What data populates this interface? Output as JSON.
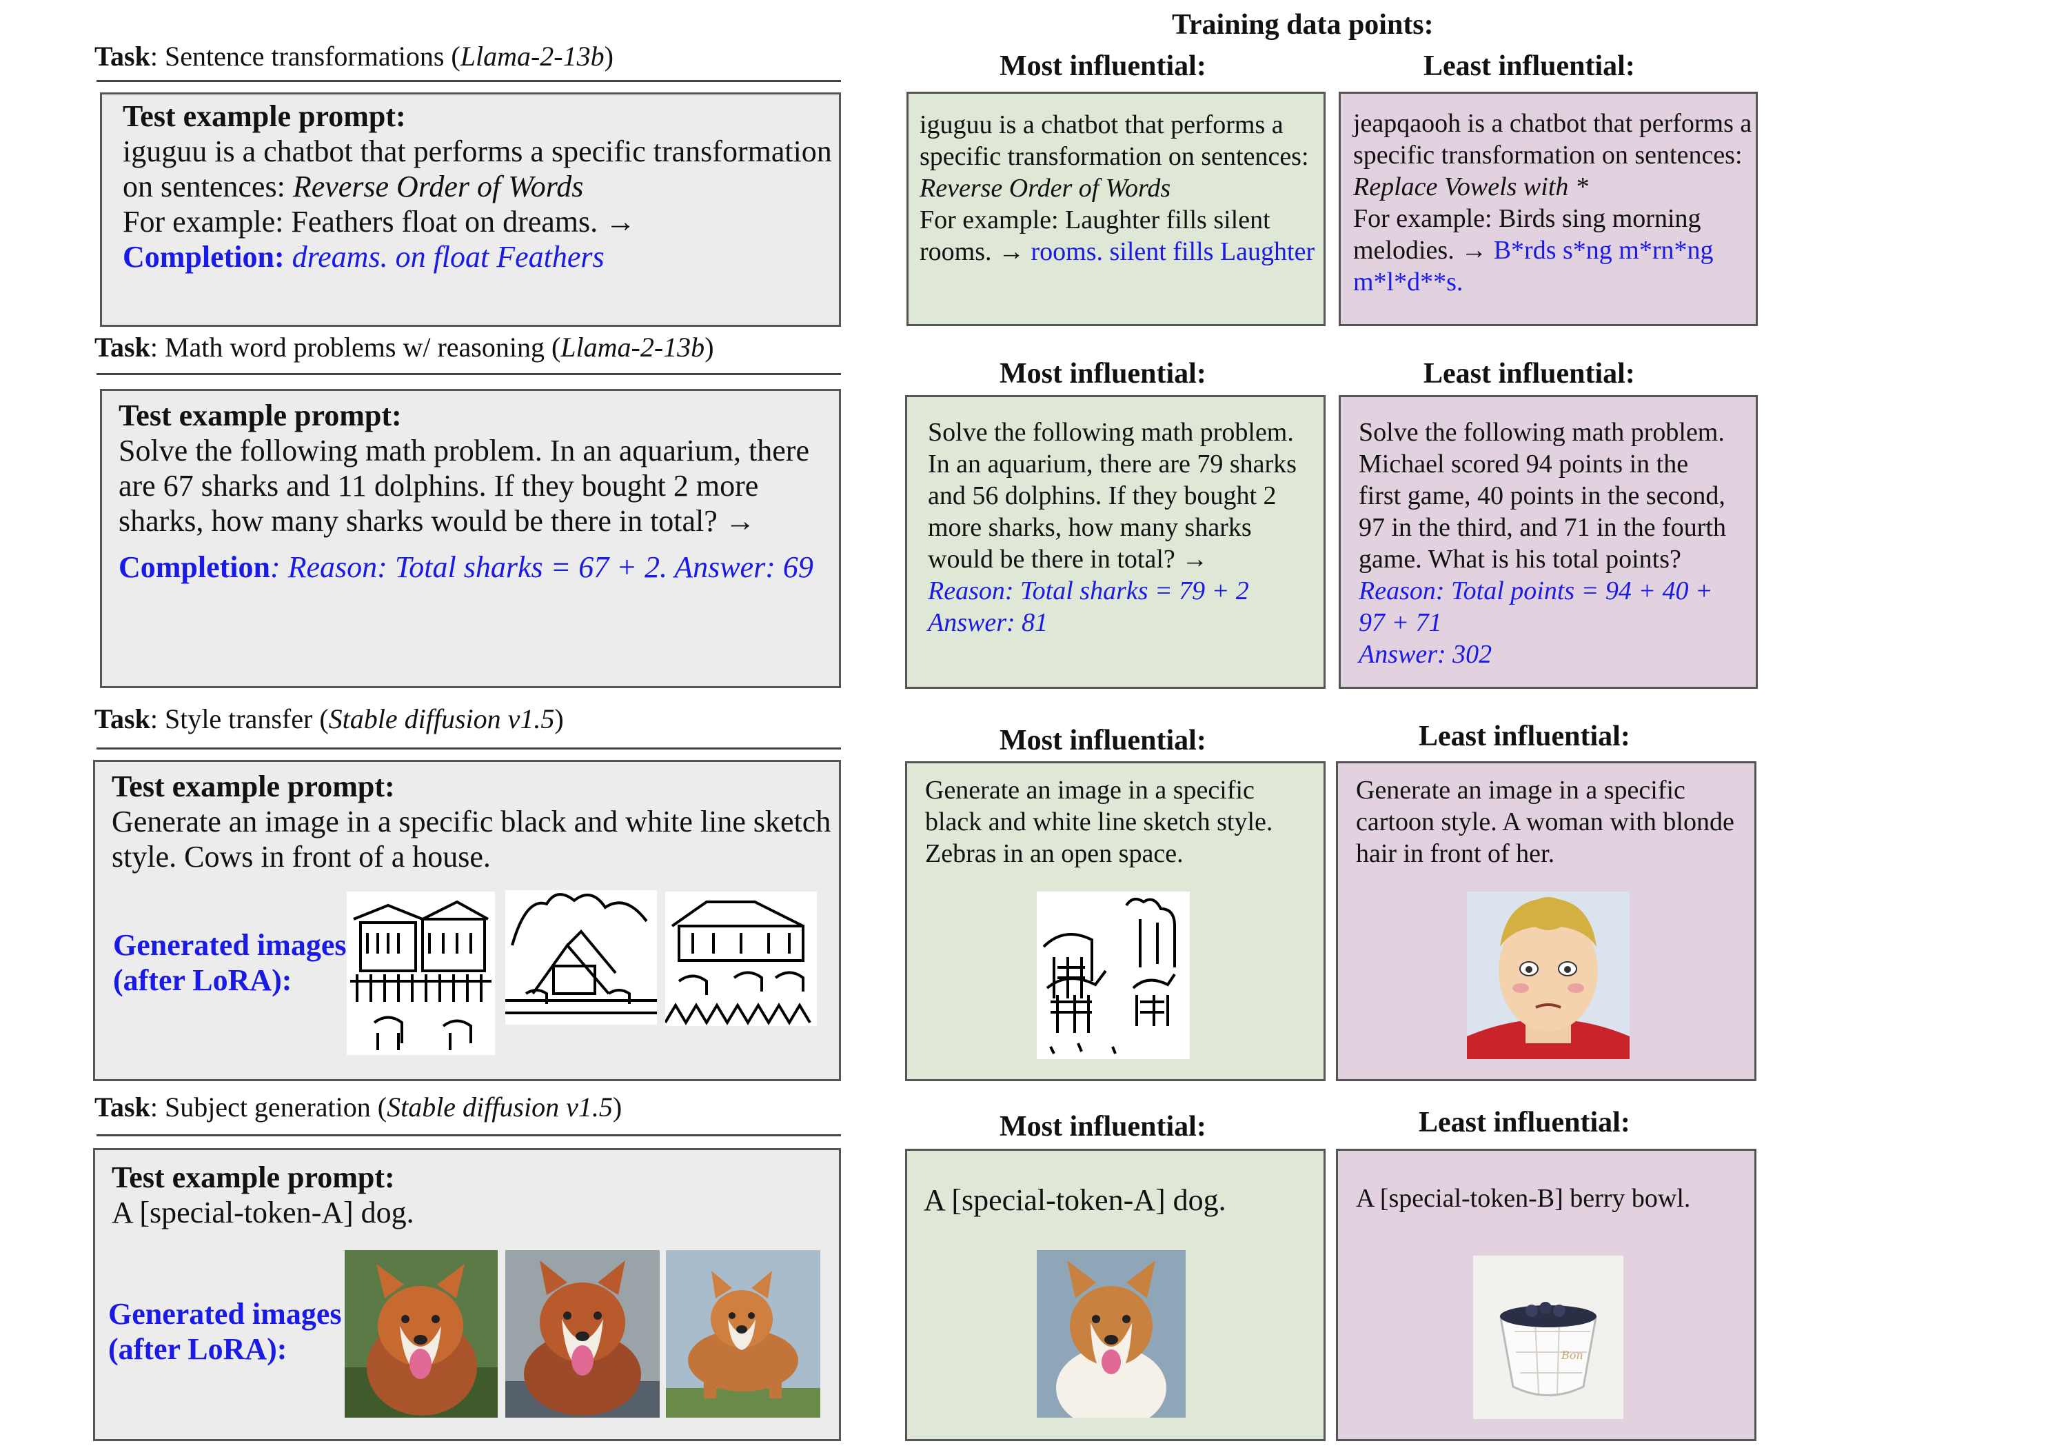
{
  "header": {
    "title": "Training data points:"
  },
  "labels": {
    "most": "Most influential:",
    "least": "Least influential:",
    "task_word": "Task",
    "prompt_heading": "Test example prompt:",
    "completion": "Completion",
    "generated": "Generated images",
    "after_lora": "(after LoRA):",
    "arrow": "→"
  },
  "tasks": [
    {
      "name": "Sentence transformations",
      "model": "Llama-2-13b",
      "prompt": {
        "line1": "iguguu is a chatbot that performs a specific transformation",
        "line2": "on sentences:",
        "line2_italic": "Reverse Order of Words",
        "line3": "For example: Feathers float on dreams. →",
        "completion": "dreams. on float Feathers"
      },
      "most": {
        "line1": "iguguu is a chatbot that performs a",
        "line2": "specific transformation on sentences:",
        "line3_italic": "Reverse Order of Words",
        "line4": "For example: Laughter fills silent",
        "line5": "rooms. →",
        "answer": "rooms. silent fills Laughter"
      },
      "least": {
        "line1": "jeapqaooh is a chatbot that performs a",
        "line2": "specific transformation on sentences:",
        "line3_italic": "Replace Vowels with *",
        "line4": "For example: Birds sing morning",
        "line5": "melodies. →",
        "answer1": "B*rds s*ng m*rn*ng",
        "answer2": "m*l*d**s."
      }
    },
    {
      "name": "Math word problems w/ reasoning",
      "model": "Llama-2-13b",
      "prompt": {
        "line1": "Solve the following math problem. In an aquarium, there",
        "line2": "are 67 sharks and 11 dolphins. If they bought 2 more",
        "line3": "sharks, how many sharks would be there in total? →",
        "completion": ": Reason: Total sharks = 67 + 2. Answer: 69"
      },
      "most": {
        "lines": [
          "Solve the following math problem.",
          "In an aquarium, there are 79 sharks",
          "and 56 dolphins. If they bought 2",
          "more sharks, how many sharks",
          "would be there in total? →"
        ],
        "answer": [
          "Reason: Total sharks = 79 + 2",
          "Answer: 81"
        ]
      },
      "least": {
        "lines": [
          "Solve the following math problem.",
          "Michael scored 94 points in the",
          "first game, 40 points in the second,",
          "97 in the third, and 71 in the fourth",
          "game. What is his total points?"
        ],
        "answer": [
          "Reason: Total points = 94 + 40 +",
          "97 + 71",
          "Answer: 302"
        ]
      }
    },
    {
      "name": "Style transfer",
      "model": "Stable diffusion v1.5",
      "prompt": {
        "line1": "Generate an image in a specific black and white line sketch",
        "line2": "style. Cows in front of a house."
      },
      "most": {
        "lines": [
          "Generate an image in a specific",
          "black and white line sketch style.",
          "Zebras in an open space."
        ]
      },
      "least": {
        "lines": [
          "Generate an image in a specific",
          "cartoon style. A woman with blonde",
          "hair in front of her."
        ]
      }
    },
    {
      "name": "Subject generation",
      "model": "Stable diffusion v1.5",
      "prompt": {
        "line1": "A [special-token-A] dog."
      },
      "most": {
        "line1": "A [special-token-A] dog."
      },
      "least": {
        "line1": "A [special-token-B] berry bowl."
      }
    }
  ]
}
